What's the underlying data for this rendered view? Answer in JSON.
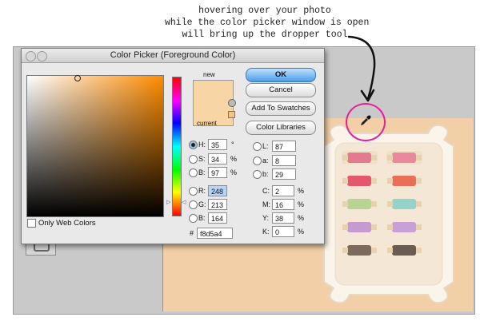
{
  "annotation": {
    "line1": "hovering over your photo",
    "line2": "while the color picker window is open",
    "line3": "will bring up the dropper tool"
  },
  "dialog": {
    "title": "Color Picker (Foreground Color)",
    "new_label": "new",
    "current_label": "current",
    "new_color": "#f8d5a4",
    "buttons": {
      "ok": "OK",
      "cancel": "Cancel",
      "add_to_swatches": "Add To Swatches",
      "color_libraries": "Color Libraries"
    },
    "hsb": {
      "h": {
        "label": "H:",
        "value": "35",
        "unit": "°"
      },
      "s": {
        "label": "S:",
        "value": "34",
        "unit": "%"
      },
      "b": {
        "label": "B:",
        "value": "97",
        "unit": "%"
      }
    },
    "rgb": {
      "r": {
        "label": "R:",
        "value": "248"
      },
      "g": {
        "label": "G:",
        "value": "213"
      },
      "b": {
        "label": "B:",
        "value": "164"
      }
    },
    "lab": {
      "l": {
        "label": "L:",
        "value": "87"
      },
      "a": {
        "label": "a:",
        "value": "8"
      },
      "b": {
        "label": "b:",
        "value": "29"
      }
    },
    "cmyk": {
      "c": {
        "label": "C:",
        "value": "2",
        "unit": "%"
      },
      "m": {
        "label": "M:",
        "value": "16",
        "unit": "%"
      },
      "y": {
        "label": "Y:",
        "value": "38",
        "unit": "%"
      },
      "k": {
        "label": "K:",
        "value": "0",
        "unit": "%"
      }
    },
    "hex": {
      "label": "#",
      "value": "f8d5a4"
    },
    "only_web_colors": "Only Web Colors"
  },
  "colors": {
    "highlight_ring": "#e81e9c",
    "ok_button": "#4b9ee8"
  },
  "icons": [
    "eyedropper-icon",
    "warning-icon",
    "cube-icon",
    "arrow-icon"
  ]
}
